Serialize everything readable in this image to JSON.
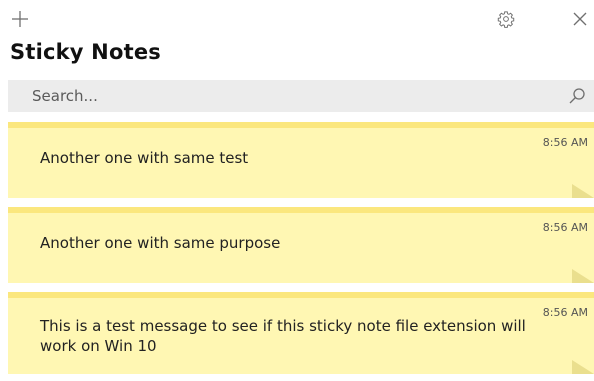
{
  "app": {
    "title": "Sticky Notes"
  },
  "toolbar": {
    "add_icon": "plus-icon",
    "settings_icon": "gear-icon",
    "close_icon": "close-icon"
  },
  "search": {
    "placeholder": "Search...",
    "value": "",
    "icon": "search-icon"
  },
  "notes": [
    {
      "time": "8:56 AM",
      "text": "Another one with same test"
    },
    {
      "time": "8:56 AM",
      "text": "Another one with same purpose"
    },
    {
      "time": "8:56 AM",
      "text": "This is a test message to see if this sticky note file extension will work on Win 10"
    }
  ],
  "colors": {
    "note_background": "#fff7b3",
    "note_header": "#fbe77e",
    "search_background": "#ececec"
  }
}
